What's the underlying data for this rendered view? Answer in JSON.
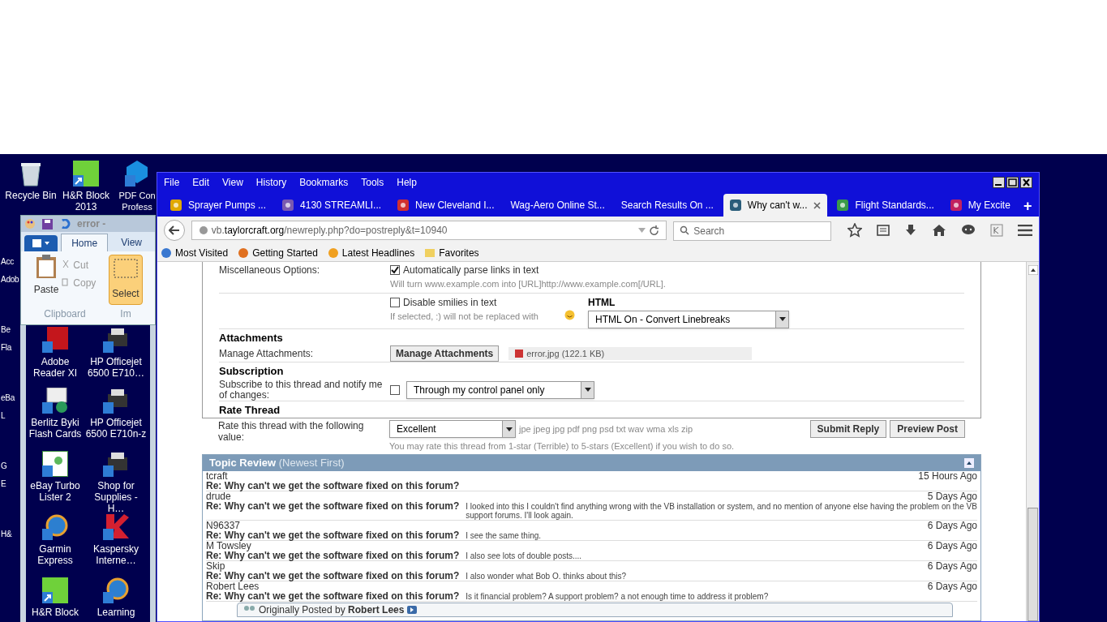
{
  "desktop": {
    "top_icons": [
      {
        "label": "Recycle Bin",
        "kind": "bin"
      },
      {
        "label": "H&R Block 2013",
        "kind": "green"
      },
      {
        "label": "PDF Con Profess",
        "kind": "pdf"
      }
    ],
    "left_column": [
      {
        "label": "Adobe Reader XI",
        "kind": "adobe"
      },
      {
        "label": "Berlitz Byki Flash Cards",
        "kind": "cards"
      },
      {
        "label": "eBay Turbo Lister 2",
        "kind": "lister"
      },
      {
        "label": "Garmin Express",
        "kind": "globe"
      },
      {
        "label": "H&R Block",
        "kind": "green"
      }
    ],
    "right_column": [
      {
        "label": "HP Officejet 6500 E710…",
        "kind": "printer"
      },
      {
        "label": "HP Officejet 6500 E710n-z",
        "kind": "printer"
      },
      {
        "label": "Shop for Supplies - H…",
        "kind": "printer"
      },
      {
        "label": "Kaspersky Interne…",
        "kind": "shield"
      },
      {
        "label": "Learning",
        "kind": "globe"
      }
    ],
    "edge_labels": [
      "Acc",
      "Adob",
      "Be",
      "Fla",
      "eBa",
      "L",
      "G",
      "E",
      "H&"
    ]
  },
  "paint_window": {
    "title": "error -",
    "tabs": [
      {
        "label": "Home",
        "selected": true
      },
      {
        "label": "View",
        "selected": false
      }
    ],
    "paste": "Paste",
    "cut": "Cut",
    "copy": "Copy",
    "group": "Clipboard",
    "select": "Select",
    "group_2": "Im"
  },
  "browser": {
    "menu": [
      "File",
      "Edit",
      "View",
      "History",
      "Bookmarks",
      "Tools",
      "Help"
    ],
    "tabs": [
      {
        "title": "Sprayer Pumps ...",
        "kind": "icon",
        "selected": false
      },
      {
        "title": "4130 STREAMLI...",
        "kind": "icon",
        "selected": false
      },
      {
        "title": "New Cleveland I...",
        "kind": "icon",
        "selected": false
      },
      {
        "title": "Wag-Aero Online St...",
        "kind": "text",
        "selected": false
      },
      {
        "title": "Search Results On ...",
        "kind": "text",
        "selected": false
      },
      {
        "title": "Why can't w...",
        "kind": "icon",
        "selected": true
      },
      {
        "title": "Flight Standards...",
        "kind": "icon",
        "selected": false
      },
      {
        "title": "My Excite",
        "kind": "icon",
        "selected": false
      }
    ],
    "new_tab": "+",
    "url": {
      "prefix": "vb.",
      "host": "taylorcraft.org",
      "path": "/newreply.php?do=postreply&t=10940"
    },
    "search": {
      "placeholder": "Search"
    },
    "bookmarks": [
      "Most Visited",
      "Getting Started",
      "Latest Headlines",
      "Favorites"
    ]
  },
  "form": {
    "misc_label": "Miscellaneous Options:",
    "parse_links": {
      "label": "Automatically parse links in text",
      "checked": true,
      "note": "Will turn www.example.com into [URL]http://www.example.com[/URL]."
    },
    "smilies": {
      "label": "Disable smilies in text",
      "checked": false,
      "note": "If selected, :) will not be replaced with"
    },
    "html": {
      "heading": "HTML",
      "value": "HTML On - Convert Linebreaks"
    },
    "attachments": {
      "heading": "Attachments",
      "label": "Manage Attachments:",
      "button": "Manage Attachments",
      "file": "error.jpg (122.1 KB)"
    },
    "subscription": {
      "heading": "Subscription",
      "label": "Subscribe to this thread and notify me of changes:",
      "checked": false,
      "value": "Through my control panel only"
    },
    "rating": {
      "heading": "Rate Thread",
      "label": "Rate this thread with the following value:",
      "value": "Excellent",
      "extensions": "jpe jpeg jpg pdf png psd txt wav wma xls zip",
      "note": "You may rate this thread from 1-star (Terrible) to 5-stars (Excellent) if you wish to do so."
    },
    "buttons": [
      "Submit Reply",
      "Preview Post"
    ]
  },
  "topic_review": {
    "title": "Topic Review",
    "subtitle": "(Newest First)",
    "posts": [
      {
        "user": "tcraft",
        "time": "15 Hours Ago",
        "title": "Re: Why can't we get the software fixed on this forum?"
      },
      {
        "user": "drude",
        "time": "5 Days Ago",
        "title": "Re: Why can't we get the software fixed on this forum?",
        "snippet": "I looked into this I couldn't find anything wrong with the VB installation or system, and no mention of anyone else having the problem on the VB support forums. I'll look again."
      },
      {
        "user": "N96337",
        "time": "6 Days Ago",
        "title": "Re: Why can't we get the software fixed on this forum?",
        "snippet": "I see the same thing."
      },
      {
        "user": "M Towsley",
        "time": "6 Days Ago",
        "title": "Re: Why can't we get the software fixed on this forum?",
        "snippet": "I also see lots of double posts...."
      },
      {
        "user": "Skip",
        "time": "6 Days Ago",
        "title": "Re: Why can't we get the software fixed on this forum?",
        "snippet": "I also wonder what Bob O. thinks about this?"
      },
      {
        "user": "Robert Lees",
        "time": "6 Days Ago",
        "title": "Re: Why can't we get the software fixed on this forum?",
        "snippet": "Is it financial problem? A support problem? a not enough time to address it problem?"
      }
    ],
    "quote": {
      "prefix": "Originally Posted by",
      "author": "Robert Lees"
    }
  }
}
